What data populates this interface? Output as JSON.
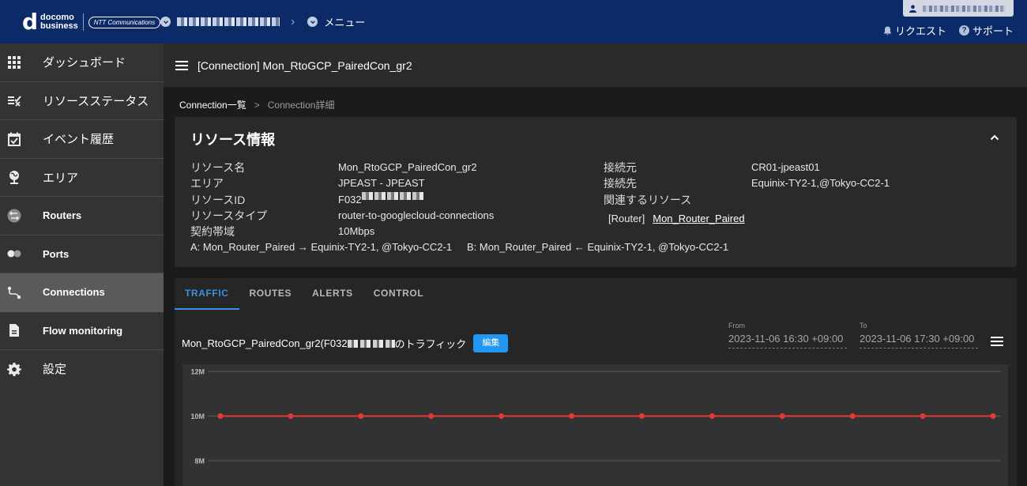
{
  "header": {
    "logo_mark": "d",
    "logo_line1": "docomo",
    "logo_line2": "business",
    "logo_partner": "NTT Communications",
    "breadcrumb_menu": "メニュー",
    "request_label": "リクエスト",
    "support_label": "サポート"
  },
  "sidebar": {
    "items": [
      {
        "label": "ダッシュボード",
        "icon": "grid-icon"
      },
      {
        "label": "リソースステータス",
        "icon": "status-list-icon"
      },
      {
        "label": "イベント履歴",
        "icon": "calendar-check-icon"
      },
      {
        "label": "エリア",
        "icon": "globe-icon"
      },
      {
        "label": "Routers",
        "icon": "router-icon"
      },
      {
        "label": "Ports",
        "icon": "ports-icon"
      },
      {
        "label": "Connections",
        "icon": "connection-icon"
      },
      {
        "label": "Flow monitoring",
        "icon": "document-icon"
      },
      {
        "label": "設定",
        "icon": "gear-icon"
      }
    ]
  },
  "titlebar": {
    "title": "[Connection] Mon_RtoGCP_PairedCon_gr2"
  },
  "breadcrumb": {
    "parent": "Connection一覧",
    "separator": ">",
    "current": "Connection詳細"
  },
  "resource": {
    "title": "リソース情報",
    "left": [
      {
        "label": "リソース名",
        "value": "Mon_RtoGCP_PairedCon_gr2"
      },
      {
        "label": "エリア",
        "value": "JPEAST - JPEAST"
      },
      {
        "label": "リソースID",
        "value": "F032"
      },
      {
        "label": "リソースタイプ",
        "value": "router-to-googlecloud-connections"
      },
      {
        "label": "契約帯域",
        "value": "10Mbps"
      }
    ],
    "right": [
      {
        "label": "接続元",
        "value": "CR01-jpeast01"
      },
      {
        "label": "接続先",
        "value": "Equinix-TY2-1,@Tokyo-CC2-1"
      },
      {
        "label": "関連するリソース",
        "value": ""
      }
    ],
    "related_type": "[Router]",
    "related_link": "Mon_Router_Paired",
    "path_a": "A: Mon_Router_Paired → Equinix-TY2-1, @Tokyo-CC2-1",
    "path_b": "B: Mon_Router_Paired ← Equinix-TY2-1, @Tokyo-CC2-1"
  },
  "tabs": [
    "TRAFFIC",
    "ROUTES",
    "ALERTS",
    "CONTROL"
  ],
  "traffic": {
    "title_prefix": "Mon_RtoGCP_PairedCon_gr2(F032",
    "title_suffix": "のトラフィック",
    "edit_label": "編集",
    "from_label": "From",
    "from_value": "2023-11-06 16:30 +09:00",
    "to_label": "To",
    "to_value": "2023-11-06 17:30 +09:00"
  },
  "chart_data": {
    "type": "line",
    "y_ticks": [
      "12M",
      "10M",
      "8M"
    ],
    "ylim": [
      8,
      12
    ],
    "series": [
      {
        "color": "#e53935",
        "values": [
          10,
          10,
          10,
          10,
          10,
          10,
          10,
          10,
          10,
          10,
          10,
          10
        ]
      }
    ],
    "grid": true
  },
  "colors": {
    "accent": "#3a8ee6",
    "header": "#0c2a67",
    "button": "#2196f3",
    "series": "#e53935"
  }
}
